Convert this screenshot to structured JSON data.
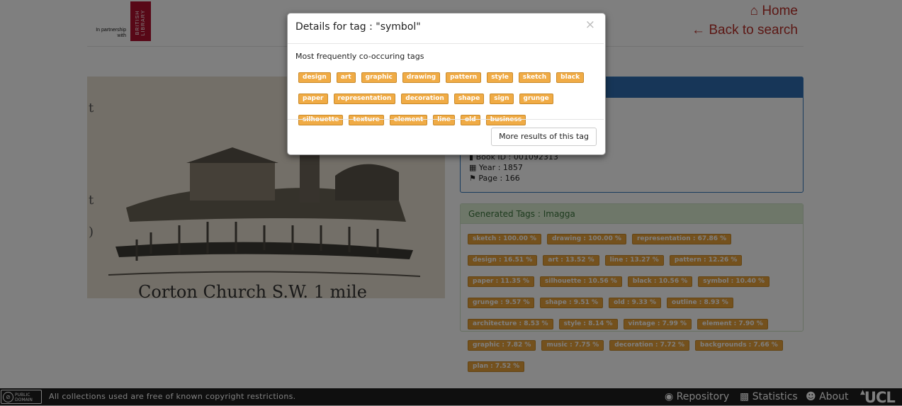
{
  "header": {
    "partner_text": "In partnership with",
    "library_text": "BRITISH LIBRARY",
    "home_label": "Home",
    "back_label": "Back to search",
    "accent_color": "#b8302a"
  },
  "image": {
    "caption": "Corton Church S.W. 1 mile"
  },
  "info": {
    "book_id": "Book ID : 001092313",
    "year": "Year : 1857",
    "page": "Page : 166"
  },
  "generated_tags": {
    "title": "Generated Tags : Imagga",
    "tags": [
      "sketch : 100.00 %",
      "drawing : 100.00 %",
      "representation : 67.86 %",
      "design : 16.51 %",
      "art : 13.52 %",
      "line : 13.27 %",
      "pattern : 12.26 %",
      "paper : 11.35 %",
      "silhouette : 10.56 %",
      "black : 10.56 %",
      "symbol : 10.40 %",
      "grunge : 9.57 %",
      "shape : 9.51 %",
      "old : 9.33 %",
      "outline : 8.93 %",
      "architecture : 8.53 %",
      "style : 8.14 %",
      "vintage : 7.99 %",
      "element : 7.90 %",
      "graphic : 7.82 %",
      "music : 7.75 %",
      "decoration : 7.72 %",
      "backgrounds : 7.66 %",
      "plan : 7.52 %"
    ]
  },
  "modal": {
    "title": "Details for tag : \"symbol\"",
    "close_glyph": "×",
    "section_label": "Most frequently co-occuring tags",
    "tags": [
      "design",
      "art",
      "graphic",
      "drawing",
      "pattern",
      "style",
      "sketch",
      "black",
      "paper",
      "representation",
      "decoration",
      "shape",
      "sign",
      "grunge",
      "silhouette",
      "texture",
      "element",
      "line",
      "old",
      "business"
    ],
    "more_button": "More results of this tag"
  },
  "footer": {
    "badge_line1": "PUBLIC",
    "badge_line2": "DOMAIN",
    "copyright": "All collections used are free of known copyright restrictions.",
    "repository": "Repository",
    "statistics": "Statistics",
    "about": "About",
    "ucl": "UCL"
  }
}
